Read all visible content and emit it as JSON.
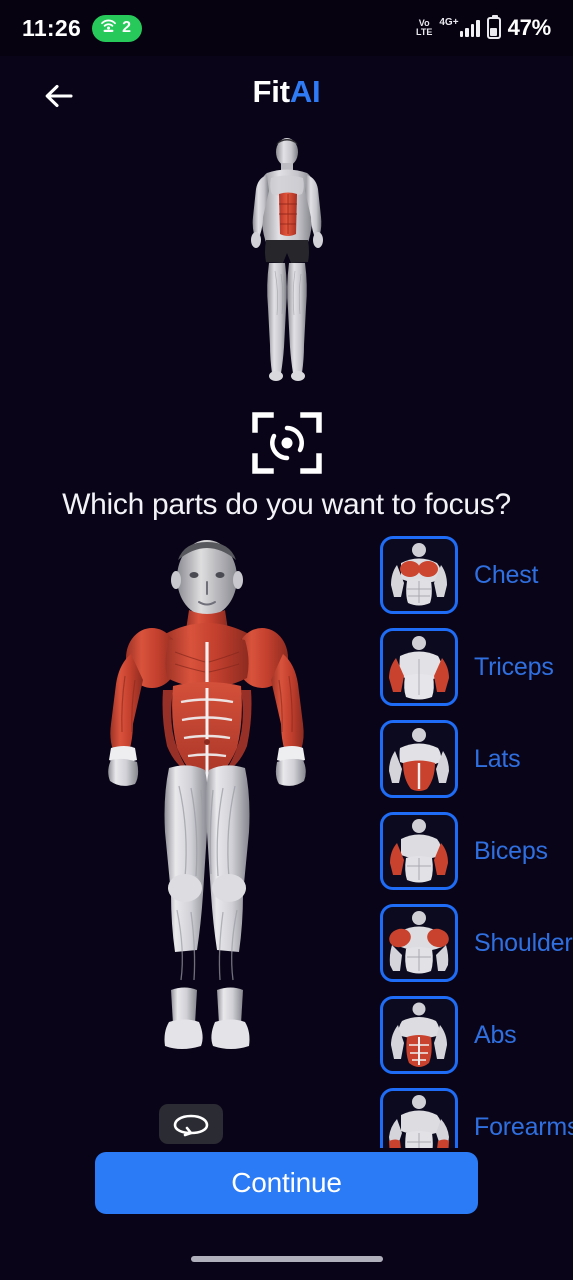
{
  "status_bar": {
    "time": "11:26",
    "hotspot_count": "2",
    "hotspot_icon": "wifi-hotspot-icon",
    "volte_line1": "Vo",
    "volte_line2": "LTE",
    "network_type": "4G+",
    "signal_icon": "signal-bars-icon",
    "battery_icon": "battery-icon",
    "battery_percent": "47%"
  },
  "app_bar": {
    "back_icon": "back-arrow-icon",
    "title_part1": "Fit",
    "title_part2": "AI"
  },
  "hero": {
    "figure_name": "anatomy-figure-abs-highlighted",
    "scan_icon": "focus-scan-icon"
  },
  "main": {
    "question": "Which parts do you want to focus?",
    "body_figure": "full-body-anatomy-front-view",
    "rotate_icon": "rotate-360-icon"
  },
  "muscle_list": [
    {
      "label": "Chest",
      "thumb": "chest-thumbnail",
      "selected": true
    },
    {
      "label": "Triceps",
      "thumb": "triceps-thumbnail",
      "selected": true
    },
    {
      "label": "Lats",
      "thumb": "lats-thumbnail",
      "selected": true
    },
    {
      "label": "Biceps",
      "thumb": "biceps-thumbnail",
      "selected": true
    },
    {
      "label": "Shoulder",
      "thumb": "shoulder-thumbnail",
      "selected": true
    },
    {
      "label": "Abs",
      "thumb": "abs-thumbnail",
      "selected": true
    },
    {
      "label": "Forearms",
      "thumb": "forearms-thumbnail",
      "selected": true
    }
  ],
  "footer": {
    "continue_label": "Continue"
  },
  "colors": {
    "background": "#090417",
    "accent_blue": "#2a7bf5",
    "border_blue": "#1f6cf7",
    "label_blue": "#2f6fe0",
    "muscle_red": "#c9402e",
    "muscle_light": "#e8e8ea",
    "hotspot_green": "#27c95b"
  }
}
